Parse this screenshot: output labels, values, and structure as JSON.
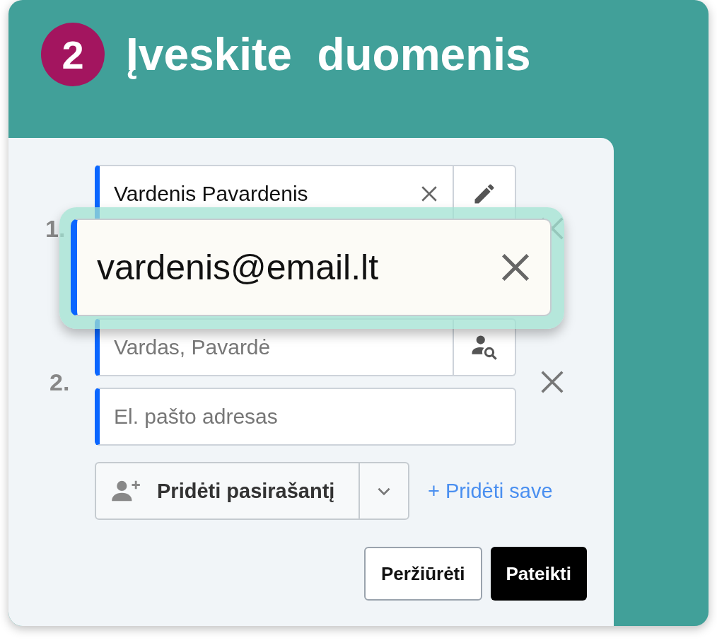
{
  "header": {
    "step": "2",
    "title": "Įveskite  duomenis"
  },
  "signers": [
    {
      "number": "1.",
      "name": {
        "value": "Vardenis Pavardenis"
      }
    },
    {
      "number": "2.",
      "name": {
        "placeholder": "Vardas, Pavardė"
      },
      "email": {
        "placeholder": "El. pašto adresas"
      }
    }
  ],
  "zoomed_field": {
    "value": "vardenis@email.lt"
  },
  "add_signer_button": "Pridėti pasirašantį",
  "add_self_link": "+ Pridėti save",
  "buttons": [
    {
      "label": "Peržiūrėti",
      "kind": "secondary"
    },
    {
      "label": "Pateikti",
      "kind": "primary"
    }
  ]
}
